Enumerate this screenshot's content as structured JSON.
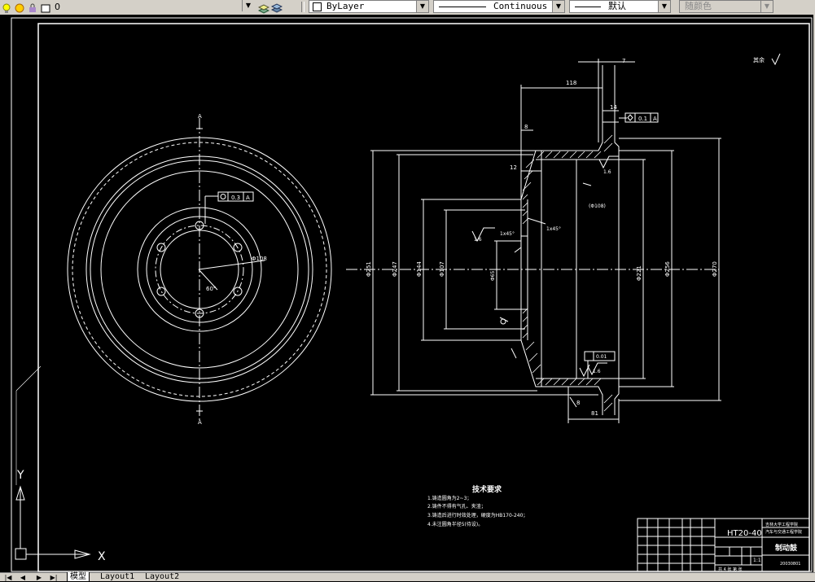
{
  "toolbar": {
    "layer_name": "0",
    "color_value": "ByLayer",
    "linetype_value": "Continuous",
    "lineweight_value": "默认",
    "plotstyle_value": "随颜色"
  },
  "tabs": [
    {
      "label": "模型",
      "active": true
    },
    {
      "label": "Layout1",
      "active": false
    },
    {
      "label": "Layout2",
      "active": false
    }
  ],
  "ucs": {
    "x_label": "X",
    "y_label": "Y"
  },
  "drawing": {
    "section_label_top": "A",
    "section_label_bottom": "A",
    "gdt_left": "0.3",
    "gdt_left_datum": "A",
    "dim_bolt_circle": "Φ108",
    "dim_angle": "60°",
    "dim_7": "7",
    "dim_118": "118",
    "dim_14": "14",
    "gdt_top": "0.1",
    "gdt_top_datum": "A",
    "dim_8": "8",
    "dim_12": "12",
    "dim_chamfer_top": "1x45°",
    "dim_chamfer_mid": "1x45°",
    "dim_d251": "Φ251",
    "dim_d247": "Φ247",
    "dim_d144": "Φ144",
    "dim_d107": "Φ107",
    "dim_d65": "Φ65",
    "dim_d221": "Φ221",
    "dim_d256": "Φ256",
    "dim_d270": "Φ270",
    "dim_bore": "(Φ108)",
    "rough_16": "1.6",
    "rough_top": "1.6",
    "rough_left": "1.6",
    "gdt_bottom": "0.01",
    "dim_81": "81",
    "dim_bottom_8": "8",
    "rough_other": "其余",
    "title_tech": "技术要求",
    "tech_notes": [
      "1.铸造圆角为2~3；",
      "2.铸件不得有气孔、夹渣；",
      "3.铸造后进行时效处理，硬度为HB170-240；",
      "4.未注圆角半径5(待设)。"
    ],
    "tb_material": "HT20-40",
    "tb_school_1": "吉林大学工程学院",
    "tb_school_2": "汽车与交通工程学院",
    "tb_partname": "制动鼓",
    "tb_scale": "1:1",
    "tb_code": "20030801",
    "tb_sheet": "共 4 张  第 张"
  },
  "colors": {
    "canvas_bg": "#000000",
    "line": "#ffffff",
    "toolbar_bg": "#d4d0c8"
  }
}
